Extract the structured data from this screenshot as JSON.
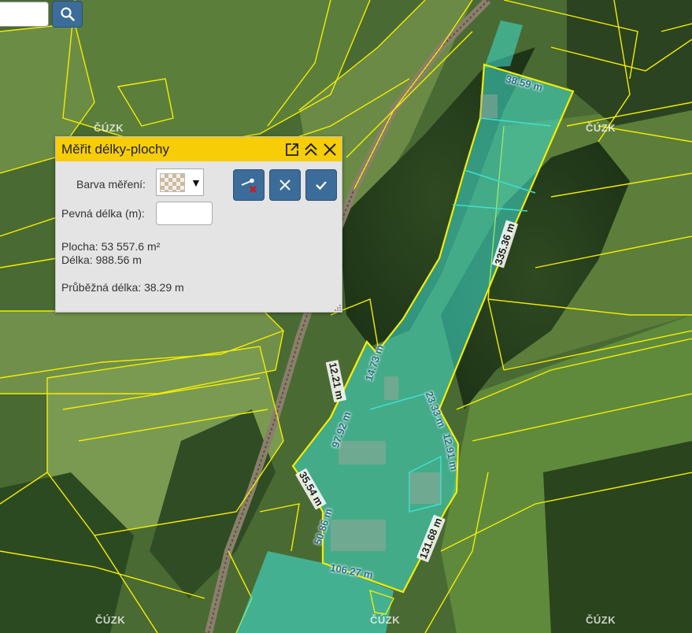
{
  "watermarks": [
    "ČÚZK",
    "ČÚZK",
    "ČÚZK",
    "ČÚZK",
    "ČÚZK"
  ],
  "measure_labels": {
    "top": "38.59 m",
    "right_long": "335.36 m",
    "seg_a": "14.73 m",
    "seg_b": "12.21 m",
    "seg_c": "97.92 m",
    "seg_d": "23.33 m",
    "seg_e": "12.91 m",
    "seg_f": "35.54 m",
    "seg_g": "50.86 m",
    "seg_h": "131.68 m",
    "bottom": "106.27 m"
  },
  "panel": {
    "title": "Měřit délky-plochy",
    "color_label": "Barva měření:",
    "fixed_length_label": "Pevná délka (m):",
    "fixed_length_value": "",
    "area": "Plocha: 53 557.6 m²",
    "length": "Délka: 988.56 m",
    "running_length": "Průběžná délka: 38.29 m"
  },
  "colors": {
    "panel_header": "#f6cd06",
    "button": "#3b6c9a",
    "measure_fill": "#40e0d0",
    "parcel_lines": "#f4ee00"
  }
}
